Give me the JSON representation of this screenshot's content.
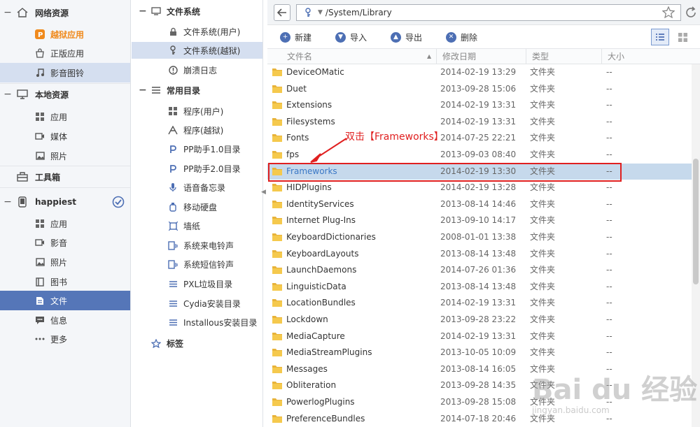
{
  "sidebar": {
    "sections": [
      {
        "label": "网络资源",
        "icon": "home-icon"
      },
      {
        "label": "本地资源",
        "icon": "monitor-icon"
      },
      {
        "label": "工具箱",
        "icon": "toolbox-icon"
      },
      {
        "label": "happiest",
        "icon": "phone-icon"
      }
    ],
    "net_items": [
      "越狱应用",
      "正版应用",
      "影音图铃"
    ],
    "local_items": [
      "应用",
      "媒体",
      "照片"
    ],
    "device_items": [
      "应用",
      "影音",
      "照片",
      "图书",
      "文件",
      "信息",
      "更多"
    ]
  },
  "tree": {
    "fs_head": "文件系统",
    "fs_items": [
      "文件系统(用户)",
      "文件系统(越狱)",
      "崩溃日志"
    ],
    "common_head": "常用目录",
    "common_items": [
      "程序(用户)",
      "程序(越狱)",
      "PP助手1.0目录",
      "PP助手2.0目录",
      "语音备忘录",
      "移动硬盘",
      "墙纸",
      "系统来电铃声",
      "系统短信铃声",
      "PXL垃圾目录",
      "Cydia安装目录",
      "Installous安装目录"
    ],
    "tags_head": "标签"
  },
  "address": {
    "path": "/System/Library"
  },
  "toolbar": {
    "new": "新建",
    "import": "导入",
    "export": "导出",
    "delete": "删除"
  },
  "table": {
    "headers": {
      "name": "文件名",
      "date": "修改日期",
      "type": "类型",
      "size": "大小"
    },
    "rows": [
      {
        "name": "DeviceOMatic",
        "date": "2014-02-19 13:29",
        "type": "文件夹",
        "size": "--"
      },
      {
        "name": "Duet",
        "date": "2013-09-28 15:06",
        "type": "文件夹",
        "size": "--"
      },
      {
        "name": "Extensions",
        "date": "2014-02-19 13:31",
        "type": "文件夹",
        "size": "--"
      },
      {
        "name": "Filesystems",
        "date": "2014-02-19 13:31",
        "type": "文件夹",
        "size": "--"
      },
      {
        "name": "Fonts",
        "date": "2014-07-25 22:21",
        "type": "文件夹",
        "size": "--"
      },
      {
        "name": "fps",
        "date": "2013-09-03 08:40",
        "type": "文件夹",
        "size": "--"
      },
      {
        "name": "Frameworks",
        "date": "2014-02-19 13:30",
        "type": "文件夹",
        "size": "--"
      },
      {
        "name": "HIDPlugins",
        "date": "2014-02-19 13:28",
        "type": "文件夹",
        "size": "--"
      },
      {
        "name": "IdentityServices",
        "date": "2013-08-14 14:46",
        "type": "文件夹",
        "size": "--"
      },
      {
        "name": "Internet Plug-Ins",
        "date": "2013-09-10 14:17",
        "type": "文件夹",
        "size": "--"
      },
      {
        "name": "KeyboardDictionaries",
        "date": "2008-01-01 13:38",
        "type": "文件夹",
        "size": "--"
      },
      {
        "name": "KeyboardLayouts",
        "date": "2013-08-14 13:48",
        "type": "文件夹",
        "size": "--"
      },
      {
        "name": "LaunchDaemons",
        "date": "2014-07-26 01:36",
        "type": "文件夹",
        "size": "--"
      },
      {
        "name": "LinguisticData",
        "date": "2013-08-14 13:48",
        "type": "文件夹",
        "size": "--"
      },
      {
        "name": "LocationBundles",
        "date": "2014-02-19 13:31",
        "type": "文件夹",
        "size": "--"
      },
      {
        "name": "Lockdown",
        "date": "2013-09-28 23:22",
        "type": "文件夹",
        "size": "--"
      },
      {
        "name": "MediaCapture",
        "date": "2014-02-19 13:31",
        "type": "文件夹",
        "size": "--"
      },
      {
        "name": "MediaStreamPlugins",
        "date": "2013-10-05 10:09",
        "type": "文件夹",
        "size": "--"
      },
      {
        "name": "Messages",
        "date": "2013-08-14 16:05",
        "type": "文件夹",
        "size": "--"
      },
      {
        "name": "Obliteration",
        "date": "2013-09-28 14:35",
        "type": "文件夹",
        "size": "--"
      },
      {
        "name": "PowerlogPlugins",
        "date": "2013-09-28 15:08",
        "type": "文件夹",
        "size": "--"
      },
      {
        "name": "PreferenceBundles",
        "date": "2014-07-18 20:46",
        "type": "文件夹",
        "size": "--"
      }
    ]
  },
  "annotation": {
    "text": "双击【Frameworks】"
  },
  "watermark": {
    "logo": "Bai du 经验",
    "url": "jingyan.baidu.com"
  },
  "colors": {
    "accent": "#4d6fb4",
    "selected_row": "#c6d9ec",
    "annotation": "#e02020",
    "orange": "#f08a1d"
  }
}
